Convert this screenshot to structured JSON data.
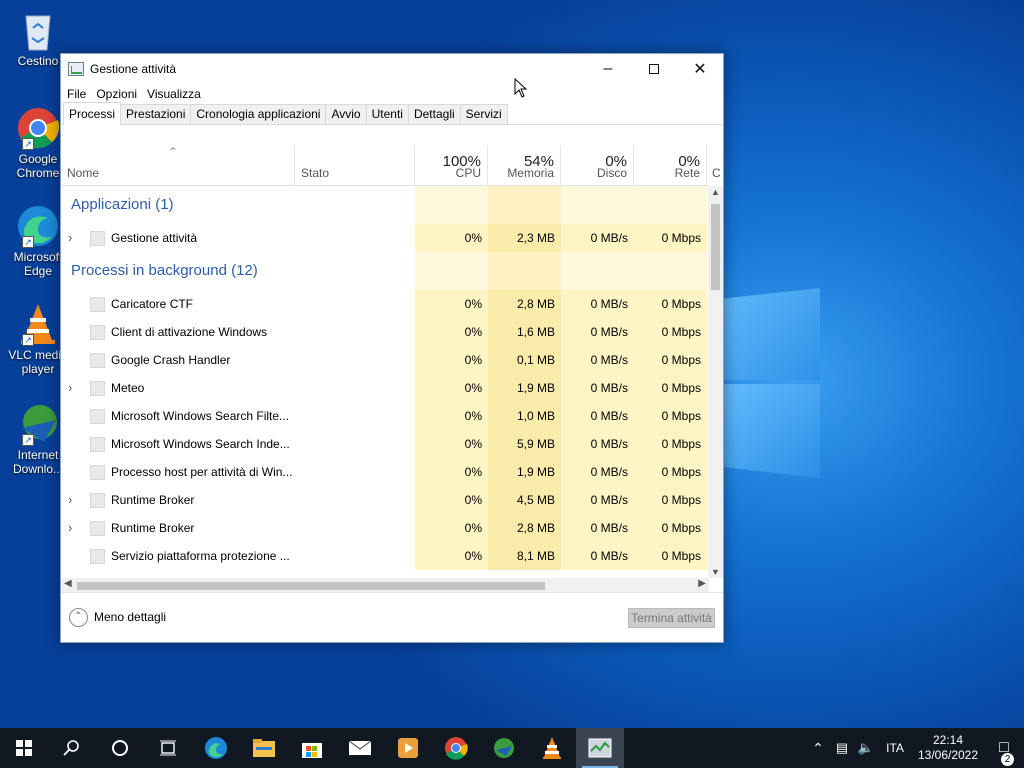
{
  "desktop": {
    "icons": [
      {
        "label": "Cestino",
        "name": "recycle-bin-icon"
      },
      {
        "label": "Google\nChrome",
        "name": "chrome-icon"
      },
      {
        "label": "Microsoft\nEdge",
        "name": "edge-icon"
      },
      {
        "label": "VLC media\nplayer",
        "name": "vlc-icon"
      },
      {
        "label": "Internet\nDownlo...",
        "name": "idm-icon"
      }
    ]
  },
  "window": {
    "title": "Gestione attività",
    "menu": [
      "File",
      "Opzioni",
      "Visualizza"
    ],
    "tabs": [
      "Processi",
      "Prestazioni",
      "Cronologia applicazioni",
      "Avvio",
      "Utenti",
      "Dettagli",
      "Servizi"
    ],
    "columns": {
      "name": "Nome",
      "status": "Stato",
      "cpu_pct": "100%",
      "cpu": "CPU",
      "mem_pct": "54%",
      "mem": "Memoria",
      "disk_pct": "0%",
      "disk": "Disco",
      "net_pct": "0%",
      "net": "Rete",
      "extra": "C"
    },
    "groups": {
      "apps": "Applicazioni (1)",
      "bg": "Processi in background (12)"
    },
    "app_rows": [
      {
        "name": "Gestione attività",
        "cpu": "0%",
        "mem": "2,3 MB",
        "disk": "0 MB/s",
        "net": "0 Mbps",
        "expand": true
      }
    ],
    "bg_rows": [
      {
        "name": "Caricatore CTF",
        "cpu": "0%",
        "mem": "2,8 MB",
        "disk": "0 MB/s",
        "net": "0 Mbps",
        "expand": false
      },
      {
        "name": "Client di attivazione Windows",
        "cpu": "0%",
        "mem": "1,6 MB",
        "disk": "0 MB/s",
        "net": "0 Mbps",
        "expand": false
      },
      {
        "name": "Google Crash Handler",
        "cpu": "0%",
        "mem": "0,1 MB",
        "disk": "0 MB/s",
        "net": "0 Mbps",
        "expand": false
      },
      {
        "name": "Meteo",
        "cpu": "0%",
        "mem": "1,9 MB",
        "disk": "0 MB/s",
        "net": "0 Mbps",
        "expand": true
      },
      {
        "name": "Microsoft Windows Search Filte...",
        "cpu": "0%",
        "mem": "1,0 MB",
        "disk": "0 MB/s",
        "net": "0 Mbps",
        "expand": false
      },
      {
        "name": "Microsoft Windows Search Inde...",
        "cpu": "0%",
        "mem": "5,9 MB",
        "disk": "0 MB/s",
        "net": "0 Mbps",
        "expand": false
      },
      {
        "name": "Processo host per attività di Win...",
        "cpu": "0%",
        "mem": "1,9 MB",
        "disk": "0 MB/s",
        "net": "0 Mbps",
        "expand": false
      },
      {
        "name": "Runtime Broker",
        "cpu": "0%",
        "mem": "4,5 MB",
        "disk": "0 MB/s",
        "net": "0 Mbps",
        "expand": true
      },
      {
        "name": "Runtime Broker",
        "cpu": "0%",
        "mem": "2,8 MB",
        "disk": "0 MB/s",
        "net": "0 Mbps",
        "expand": true
      },
      {
        "name": "Servizio piattaforma protezione ...",
        "cpu": "0%",
        "mem": "8,1 MB",
        "disk": "0 MB/s",
        "net": "0 Mbps",
        "expand": false
      }
    ],
    "footer": {
      "less": "Meno dettagli",
      "end": "Termina attività"
    }
  },
  "taskbar": {
    "lang": "ITA",
    "time": "22:14",
    "date": "13/06/2022",
    "notif_count": "2"
  }
}
